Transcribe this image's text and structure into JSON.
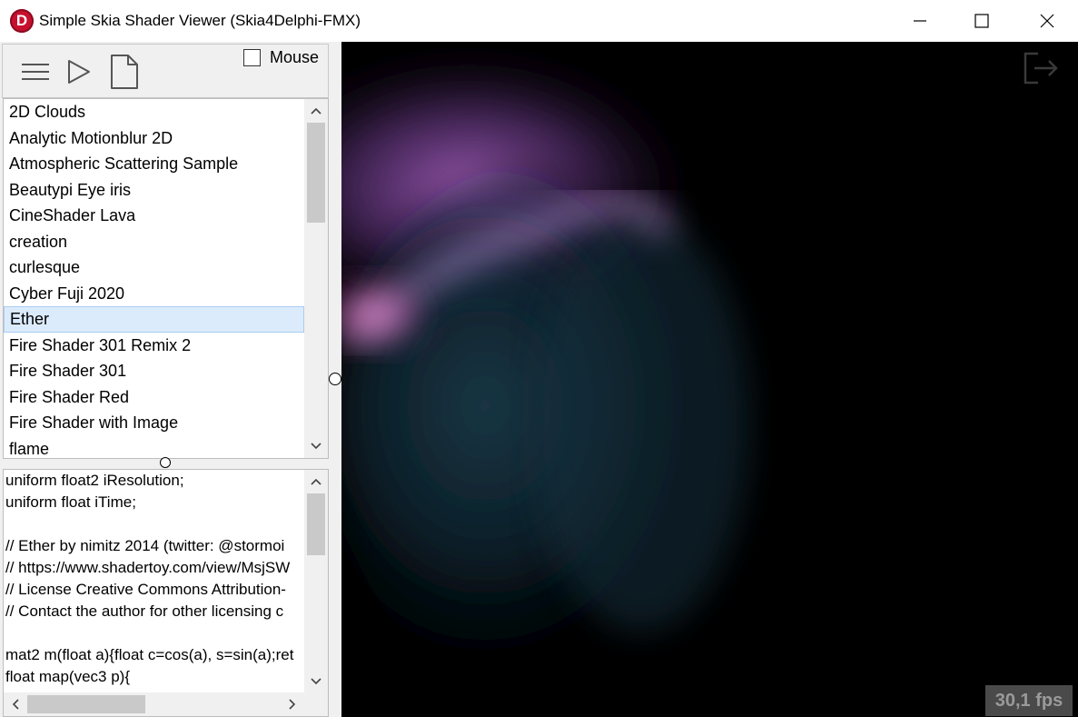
{
  "window": {
    "title": "Simple Skia Shader Viewer (Skia4Delphi-FMX)",
    "app_icon_letter": "D",
    "app_icon_color": "#c8102e",
    "controls": [
      "minimize-icon",
      "maximize-icon",
      "close-icon"
    ]
  },
  "toolbar": {
    "menu_icon": "hamburger-icon",
    "play_icon": "play-icon",
    "new_icon": "document-icon",
    "mouse_label": "Mouse",
    "mouse_checked": false
  },
  "shader_list": {
    "items": [
      "2D Clouds",
      "Analytic Motionblur 2D",
      "Atmospheric Scattering Sample",
      "Beautypi Eye iris",
      "CineShader Lava",
      "creation",
      "curlesque",
      "Cyber Fuji 2020",
      "Ether",
      "Fire Shader 301 Remix 2",
      "Fire Shader 301",
      "Fire Shader Red",
      "Fire Shader with Image",
      "flame"
    ],
    "selected": "Ether",
    "selection_color": "#dcebfc"
  },
  "code_editor": {
    "lines": [
      "uniform float2 iResolution;",
      "uniform float iTime;",
      "",
      "// Ether by nimitz 2014 (twitter: @stormoi",
      "// https://www.shadertoy.com/view/MsjSW",
      "// License Creative Commons Attribution-",
      "// Contact the author for other licensing c",
      "",
      "mat2 m(float a){float c=cos(a), s=sin(a);ret",
      "float map(vec3 p){"
    ]
  },
  "viewer": {
    "fps_text": "30,1 fps",
    "exit_icon": "exit-icon",
    "background": "#000000"
  }
}
